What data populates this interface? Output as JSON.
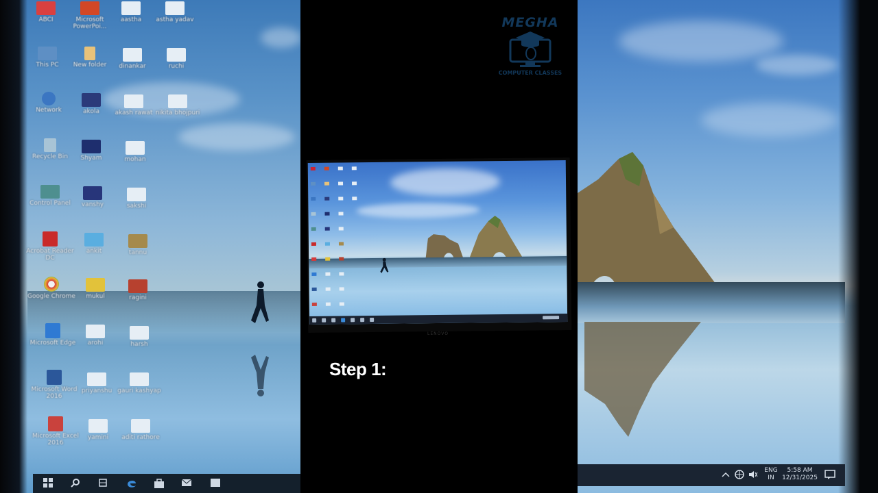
{
  "left_desktop": {
    "icons": [
      {
        "label": "ABCI",
        "icon": "app-red-icon"
      },
      {
        "label": "Microsoft PowerPoi...",
        "icon": "powerpoint-icon"
      },
      {
        "label": "aastha",
        "icon": "folder-icon"
      },
      {
        "label": "astha yadav",
        "icon": "folder-icon"
      },
      {
        "label": "This PC",
        "icon": "computer-icon"
      },
      {
        "label": "New folder",
        "icon": "folder-icon"
      },
      {
        "label": "dinankar",
        "icon": "folder-icon"
      },
      {
        "label": "ruchi",
        "icon": "folder-icon"
      },
      {
        "label": "Network",
        "icon": "network-icon"
      },
      {
        "label": "akola",
        "icon": "image-icon"
      },
      {
        "label": "akash rawat",
        "icon": "folder-icon"
      },
      {
        "label": "nikita bhojpuri",
        "icon": "folder-icon"
      },
      {
        "label": "Recycle Bin",
        "icon": "recycle-bin-icon"
      },
      {
        "label": "Shyam",
        "icon": "image-icon"
      },
      {
        "label": "mohan",
        "icon": "folder-icon"
      },
      {
        "label": "Control Panel",
        "icon": "control-panel-icon"
      },
      {
        "label": "vanshy",
        "icon": "image-icon"
      },
      {
        "label": "sakshi",
        "icon": "folder-icon"
      },
      {
        "label": "Acrobat Reader DC",
        "icon": "acrobat-icon"
      },
      {
        "label": "ankit",
        "icon": "image-icon"
      },
      {
        "label": "tannu",
        "icon": "image-icon"
      },
      {
        "label": "Google Chrome",
        "icon": "chrome-icon"
      },
      {
        "label": "mukul",
        "icon": "folder-yellow-icon"
      },
      {
        "label": "ragini",
        "icon": "image-icon"
      },
      {
        "label": "Microsoft Edge",
        "icon": "edge-icon"
      },
      {
        "label": "arohi",
        "icon": "folder-icon"
      },
      {
        "label": "harsh",
        "icon": "folder-icon"
      },
      {
        "label": "Microsoft Word 2016",
        "icon": "word-icon"
      },
      {
        "label": "priyanshu",
        "icon": "folder-icon"
      },
      {
        "label": "gauri kashyap",
        "icon": "folder-icon"
      },
      {
        "label": "Microsoft Excel 2016",
        "icon": "excel-icon"
      },
      {
        "label": "yamini",
        "icon": "folder-icon"
      },
      {
        "label": "aditi rathore",
        "icon": "folder-icon"
      }
    ],
    "taskbar_icons": [
      "start-icon",
      "search-icon",
      "task-view-icon",
      "edge-icon",
      "store-icon",
      "mail-icon",
      "file-icon"
    ]
  },
  "logo": {
    "title": "MEGHA",
    "subtitle": "COMPUTER CLASSES"
  },
  "monitor": {
    "brand": "LENOVO"
  },
  "step_text": "Step 1:",
  "right_tray": {
    "lang_top": "ENG",
    "lang_bottom": "IN",
    "time": "5:58 AM",
    "date": "12/31/2025"
  },
  "colors": {
    "sky": "#5a93c8",
    "taskbar": "#1a2432",
    "logo": "#12385a"
  }
}
